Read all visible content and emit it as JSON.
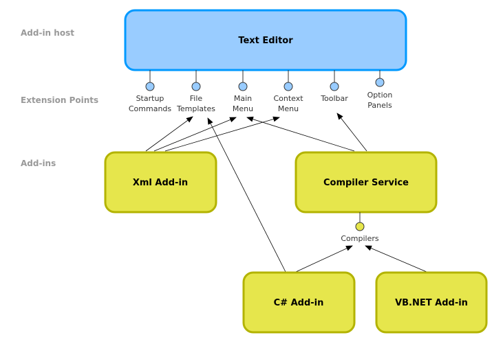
{
  "layers": {
    "host": "Add-in host",
    "extension_points": "Extension Points",
    "addins": "Add-ins"
  },
  "host": {
    "label": "Text Editor",
    "color": "#99ccff",
    "border": "#0099ff"
  },
  "extension_points": [
    {
      "line1": "Startup",
      "line2": "Commands"
    },
    {
      "line1": "File",
      "line2": "Templates"
    },
    {
      "line1": "Main",
      "line2": "Menu"
    },
    {
      "line1": "Context",
      "line2": "Menu"
    },
    {
      "line1": "Toolbar",
      "line2": ""
    },
    {
      "line1": "Option",
      "line2": "Panels"
    }
  ],
  "addins": {
    "xml": "Xml Add-in",
    "compiler": "Compiler Service",
    "csharp": "C# Add-in",
    "vbnet": "VB.NET Add-in",
    "color": "#e6e64c",
    "border": "#b3b300"
  },
  "compilers_point": "Compilers",
  "edges": [
    {
      "from": "Xml Add-in",
      "to": "File Templates"
    },
    {
      "from": "Xml Add-in",
      "to": "Main Menu"
    },
    {
      "from": "Xml Add-in",
      "to": "Context Menu"
    },
    {
      "from": "Compiler Service",
      "to": "Main Menu"
    },
    {
      "from": "Compiler Service",
      "to": "Toolbar"
    },
    {
      "from": "C# Add-in",
      "to": "File Templates"
    },
    {
      "from": "C# Add-in",
      "to": "Compilers"
    },
    {
      "from": "VB.NET Add-in",
      "to": "Compilers"
    }
  ]
}
